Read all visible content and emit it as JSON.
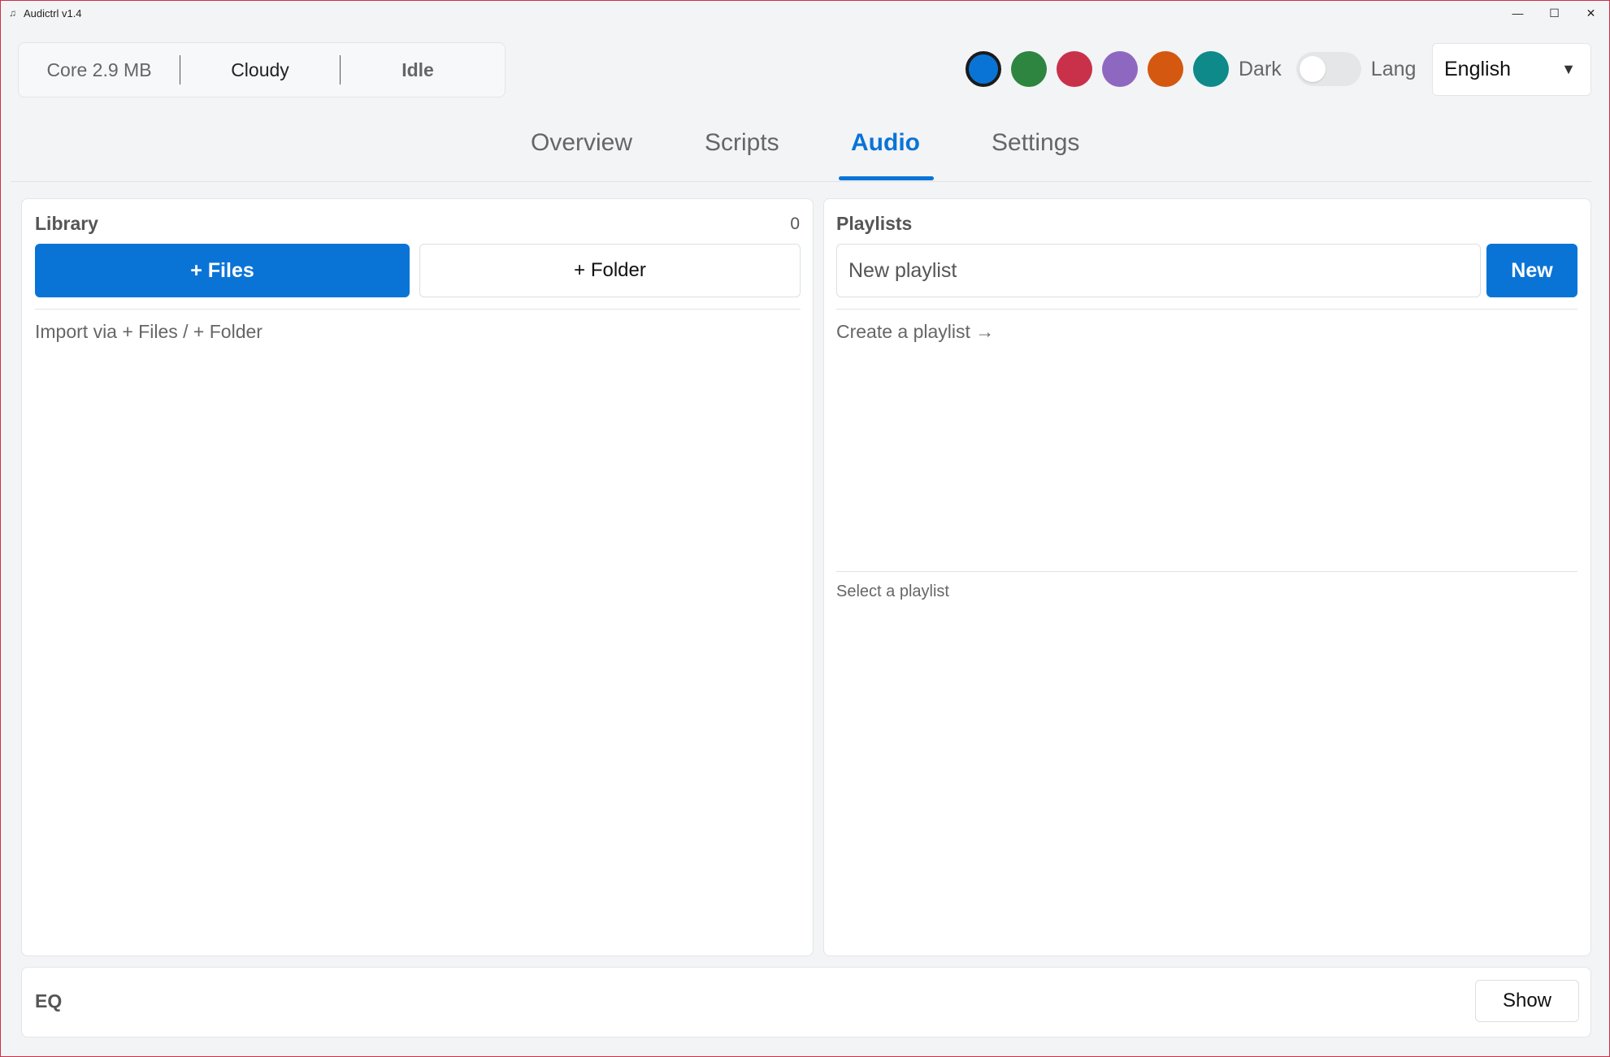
{
  "window": {
    "title": "Audictrl v1.4",
    "icon": "music-note-icon",
    "controls": {
      "minimize": "—",
      "maximize": "☐",
      "close": "✕"
    }
  },
  "status": {
    "core": "Core 2.9 MB",
    "weather": "Cloudy",
    "state": "Idle"
  },
  "theme": {
    "swatches": [
      {
        "name": "blue",
        "color": "#0a74d6",
        "selected": true
      },
      {
        "name": "green",
        "color": "#2e8540"
      },
      {
        "name": "red",
        "color": "#c9314a"
      },
      {
        "name": "purple",
        "color": "#8e68c0"
      },
      {
        "name": "orange",
        "color": "#d4580f"
      },
      {
        "name": "teal",
        "color": "#0f8a8a"
      }
    ],
    "dark_label": "Dark",
    "dark_enabled": false,
    "lang_label": "Lang",
    "language": "English"
  },
  "tabs": [
    {
      "label": "Overview"
    },
    {
      "label": "Scripts"
    },
    {
      "label": "Audio",
      "active": true
    },
    {
      "label": "Settings"
    }
  ],
  "library": {
    "title": "Library",
    "count": "0",
    "add_files": "+ Files",
    "add_folder": "+ Folder",
    "empty_hint": "Import via + Files / + Folder"
  },
  "playlists": {
    "title": "Playlists",
    "input_placeholder": "New playlist",
    "new_button": "New",
    "empty_hint": "Create a playlist →",
    "detail_hint": "Select a playlist"
  },
  "eq": {
    "title": "EQ",
    "toggle_button": "Show"
  },
  "colors": {
    "accent": "#0a74d6",
    "window_border": "#c9314a"
  }
}
